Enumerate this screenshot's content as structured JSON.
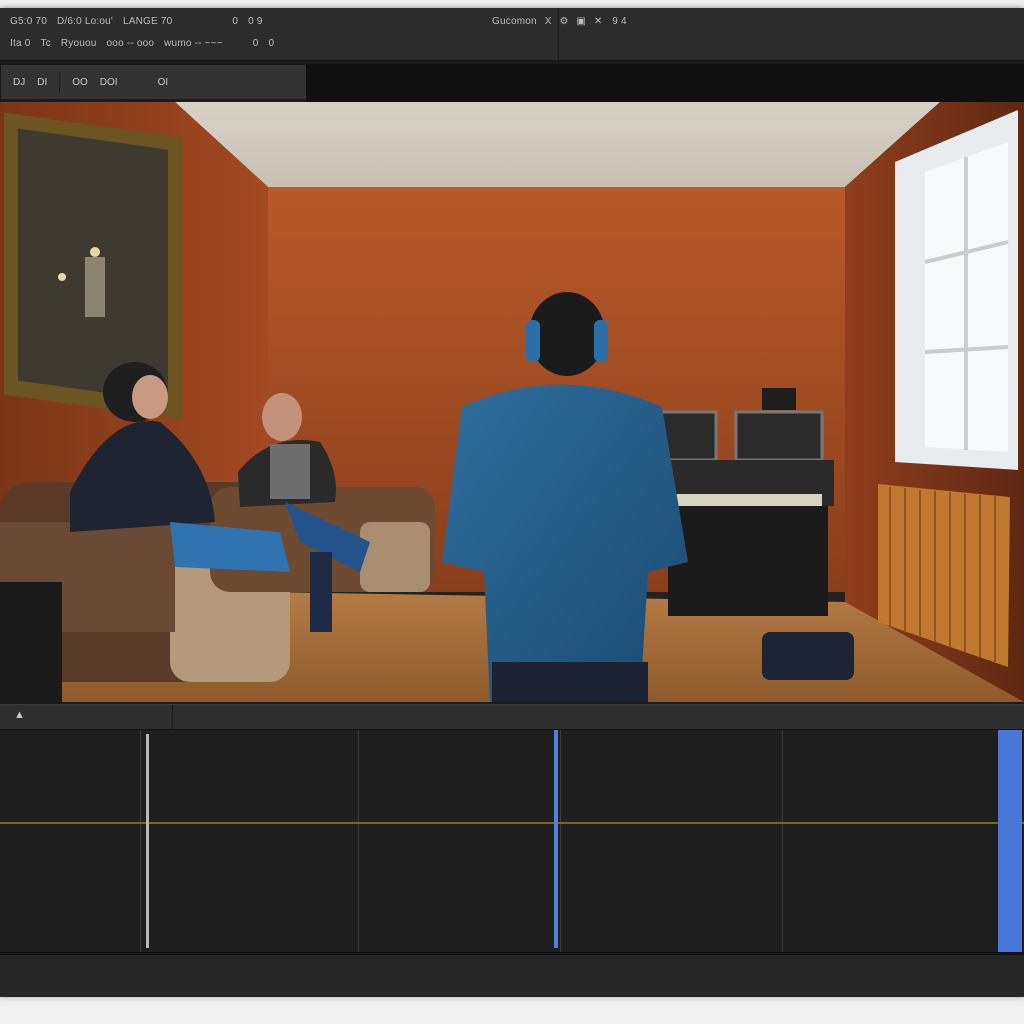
{
  "menubar": {
    "row1": [
      "G5:0 70",
      "D/6:0 Lo:ou'",
      "LANGE 70",
      "0",
      "0 9",
      "Gucomon",
      "X",
      "9 4"
    ],
    "row2": [
      "Ita 0",
      "Tc",
      "Ryouou",
      "ooo -- ooo",
      "wumo -- ~~~",
      "0",
      "0"
    ],
    "title_icons": [
      "⚙",
      "▣",
      "✕"
    ]
  },
  "toolstrip": {
    "items": [
      "DJ",
      "DI",
      "OO",
      "DOI",
      "OI"
    ]
  },
  "timeline": {
    "marker_label": "▲"
  },
  "colors": {
    "window_bg": "#1b1b1b",
    "playhead": "#4f7fe0",
    "end_block": "#4a78d8",
    "track_line": "#6e6a1e"
  }
}
